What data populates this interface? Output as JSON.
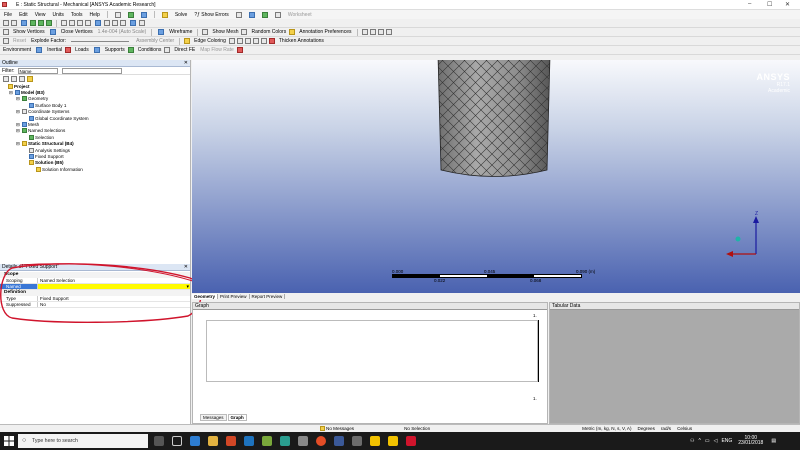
{
  "titlebar": {
    "title": "E : Static Structural - Mechanical [ANSYS Academic Research]",
    "minimize": "–",
    "maximize": "☐",
    "close": "✕"
  },
  "menu": [
    "File",
    "Edit",
    "View",
    "Units",
    "Tools",
    "Help"
  ],
  "toolbar1": {
    "solve": "Solve",
    "show_errors": "?ƒ Show Errors",
    "worksheet": "Worksheet"
  },
  "toolbar2": {
    "show_vertices": "Show Vertices",
    "close_vertices": "Close Vertices",
    "auto_scale": "1.4e-004 (Auto Scale)",
    "wireframe": "Wireframe",
    "show_mesh": "Show Mesh",
    "random_colors": "Random Colors",
    "annotation_prefs": "Annotation Preferences"
  },
  "toolbar3": {
    "reset": "Reset",
    "explode_factor": "Explode Factor:",
    "assembly_center": "Assembly Center",
    "edge_coloring": "Edge Coloring",
    "thicken_annotations": "Thicken Annotations"
  },
  "toolbar4": {
    "environment": "Environment",
    "inertial": "Inertial",
    "loads": "Loads",
    "supports": "Supports",
    "conditions": "Conditions",
    "direct_fe": "Direct FE",
    "map_rule": "Map Flow Rate"
  },
  "outline": {
    "title": "Outline",
    "filter_label": "Filter:",
    "filter_value": "Name",
    "tree": [
      {
        "label": "Project",
        "level": 0,
        "bold": true
      },
      {
        "label": "Model (B3)",
        "level": 1,
        "bold": true
      },
      {
        "label": "Geometry",
        "level": 2,
        "bold": false
      },
      {
        "label": "Surface Body 1",
        "level": 3,
        "bold": false
      },
      {
        "label": "Coordinate Systems",
        "level": 2,
        "bold": false
      },
      {
        "label": "Global Coordinate System",
        "level": 3,
        "bold": false
      },
      {
        "label": "Mesh",
        "level": 2,
        "bold": false
      },
      {
        "label": "Named Selections",
        "level": 2,
        "bold": false
      },
      {
        "label": "Selection",
        "level": 3,
        "bold": false
      },
      {
        "label": "Static Structural (B4)",
        "level": 2,
        "bold": true
      },
      {
        "label": "Analysis Settings",
        "level": 3,
        "bold": false
      },
      {
        "label": "Fixed Support",
        "level": 3,
        "bold": false
      },
      {
        "label": "Solution (B5)",
        "level": 3,
        "bold": true
      },
      {
        "label": "Solution Information",
        "level": 4,
        "bold": false
      }
    ]
  },
  "details": {
    "title": "Details of \"Fixed Support\"",
    "scope_header": "Scope",
    "scoping_method_label": "Scoping Method",
    "scoping_method_value": "Named Selection",
    "named_selection_label": "Named Selection",
    "named_selection_value": "",
    "definition_header": "Definition",
    "type_label": "Type",
    "type_value": "Fixed Support",
    "suppressed_label": "Suppressed",
    "suppressed_value": "No"
  },
  "viewport": {
    "logo": "ANSYS",
    "version": "R17.1",
    "edition": "Academic",
    "scale_labels": [
      "0.000",
      "0.045",
      "0.090 (m)"
    ],
    "scale_sub_labels": [
      "0.022",
      "0.068"
    ],
    "axis_z": "Z"
  },
  "view_tabs": [
    "Geometry",
    "Print Preview",
    "Report Preview"
  ],
  "graph": {
    "title": "Graph",
    "axis_value_top": "1.",
    "axis_value_bottom": "1."
  },
  "tabular": {
    "title": "Tabular Data"
  },
  "graph_tabs": [
    "Messages",
    "Graph"
  ],
  "status": {
    "messages": "No Messages",
    "selection": "No Selection",
    "units": "Metric (m, kg, N, s, V, A)",
    "degrees": "Degrees",
    "rad": "rad/s",
    "celsius": "Celsius"
  },
  "taskbar": {
    "search_placeholder": "Type here to search",
    "lang": "ENG",
    "time": "10:00",
    "date": "23/01/2018"
  },
  "colors": {
    "accent_blue": "#3a77d6",
    "highlight_yellow": "#fffb00",
    "annotation_red": "#d0142c"
  }
}
